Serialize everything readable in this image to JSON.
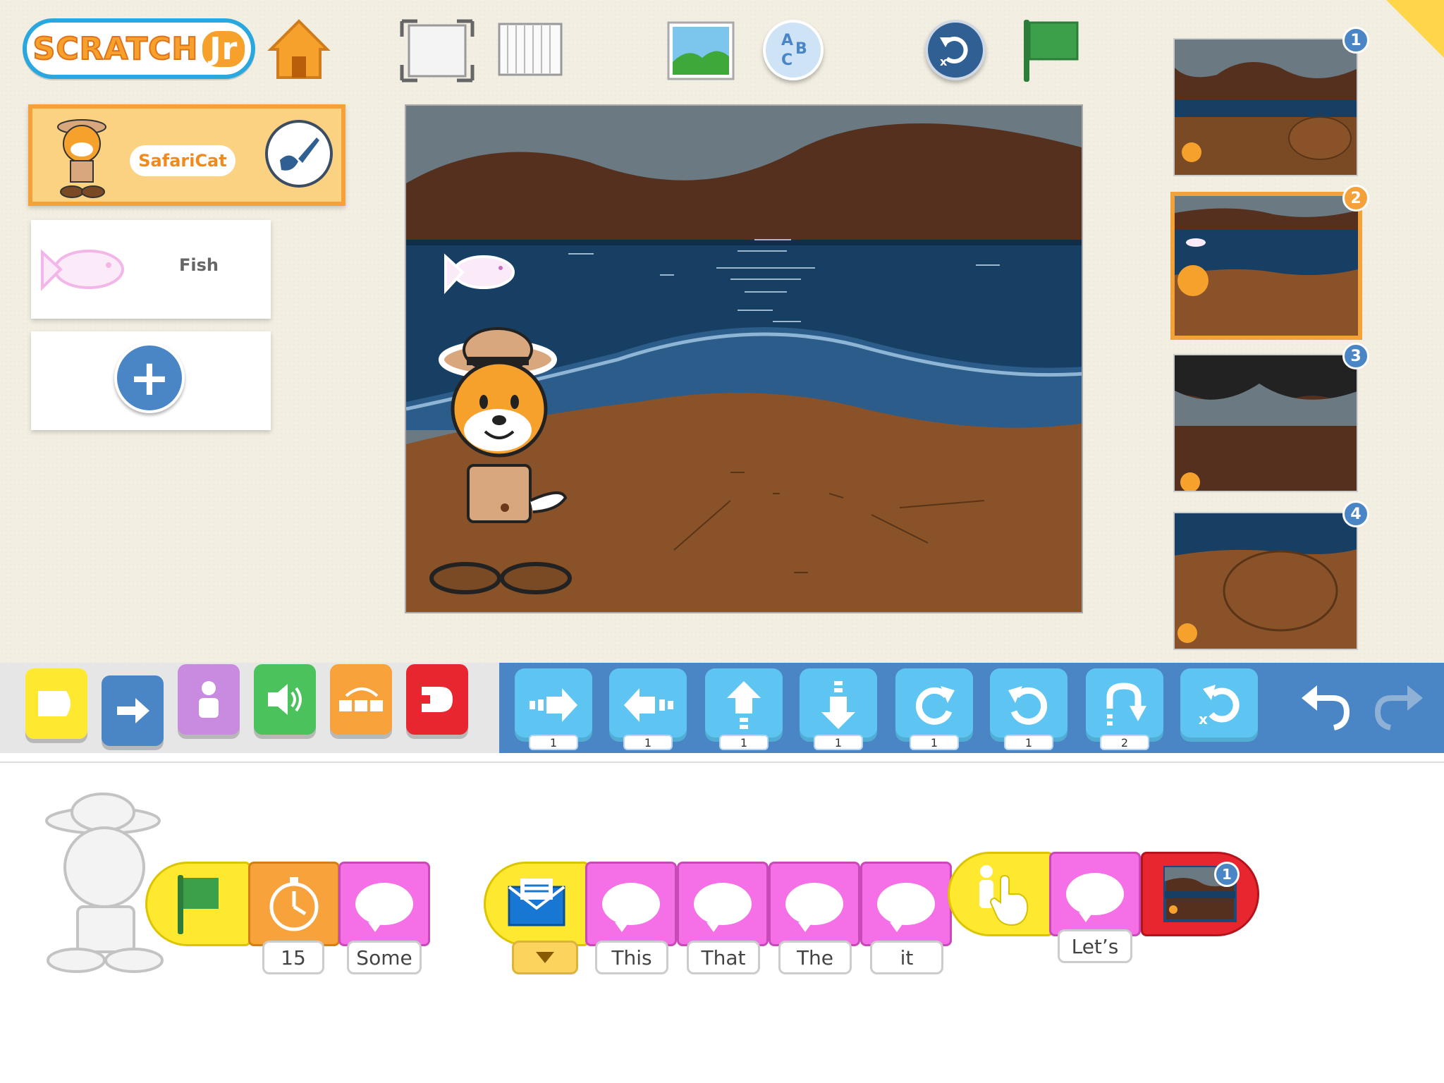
{
  "app": {
    "logo_main": "SCRATCH",
    "logo_jr": "Jr"
  },
  "toolbar": {
    "home": "home-icon",
    "fullscreen": "fullscreen-icon",
    "grid": "grid-icon",
    "background": "background-image-icon",
    "text": "abc-text-icon",
    "reset": "reset-characters-icon",
    "green_flag": "green-flag-icon"
  },
  "sprites": {
    "items": [
      {
        "name": "SafariCat",
        "selected": true
      },
      {
        "name": "Fish",
        "selected": false
      }
    ],
    "add_label": "+"
  },
  "pages": {
    "items": [
      {
        "number": "1",
        "selected": false
      },
      {
        "number": "2",
        "selected": true
      },
      {
        "number": "3",
        "selected": false
      },
      {
        "number": "4",
        "selected": false
      }
    ]
  },
  "palette": {
    "categories": [
      {
        "name": "triggering",
        "color": "#ffe930"
      },
      {
        "name": "motion",
        "color": "#4a86c5"
      },
      {
        "name": "looks",
        "color": "#c98be0"
      },
      {
        "name": "sound",
        "color": "#4bc25c"
      },
      {
        "name": "control",
        "color": "#f8a23b"
      },
      {
        "name": "end",
        "color": "#e8262f"
      }
    ],
    "motion_blocks": [
      {
        "name": "move-right",
        "value": "1"
      },
      {
        "name": "move-left",
        "value": "1"
      },
      {
        "name": "move-up",
        "value": "1"
      },
      {
        "name": "move-down",
        "value": "1"
      },
      {
        "name": "turn-right",
        "value": "1"
      },
      {
        "name": "turn-left",
        "value": "1"
      },
      {
        "name": "hop",
        "value": "2"
      },
      {
        "name": "go-home",
        "value": ""
      }
    ]
  },
  "scripts": {
    "script1": {
      "wait_value": "15",
      "say_text": "Some"
    },
    "script2": {
      "say_texts": [
        "This",
        "That",
        "The",
        "it"
      ],
      "say_last": "Let’s",
      "goto_page": "1"
    }
  }
}
